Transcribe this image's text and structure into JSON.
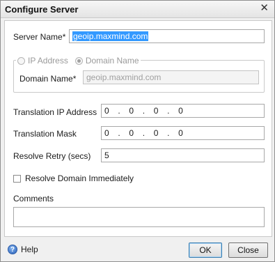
{
  "window": {
    "title": "Configure Server",
    "close_glyph": "✕"
  },
  "form": {
    "server_name": {
      "label": "Server Name*",
      "value": "geoip.maxmind.com"
    },
    "group": {
      "ip_option_label": "IP Address",
      "domain_option_label": "Domain Name",
      "selected": "Domain Name"
    },
    "domain_name": {
      "label": "Domain Name*",
      "placeholder": "geoip.maxmind.com"
    },
    "translation_ip": {
      "label": "Translation IP Address",
      "octets": [
        "0",
        "0",
        "0",
        "0"
      ]
    },
    "translation_mask": {
      "label": "Translation Mask",
      "octets": [
        "0",
        "0",
        "0",
        "0"
      ]
    },
    "resolve_retry": {
      "label": "Resolve Retry (secs)",
      "value": "5"
    },
    "resolve_immediately": {
      "label": "Resolve Domain Immediately",
      "checked": false
    },
    "comments": {
      "label": "Comments",
      "value": ""
    }
  },
  "footer": {
    "help_label": "Help",
    "ok_label": "OK",
    "close_label": "Close"
  },
  "icons": {
    "help": "help-icon",
    "close": "close-icon"
  }
}
